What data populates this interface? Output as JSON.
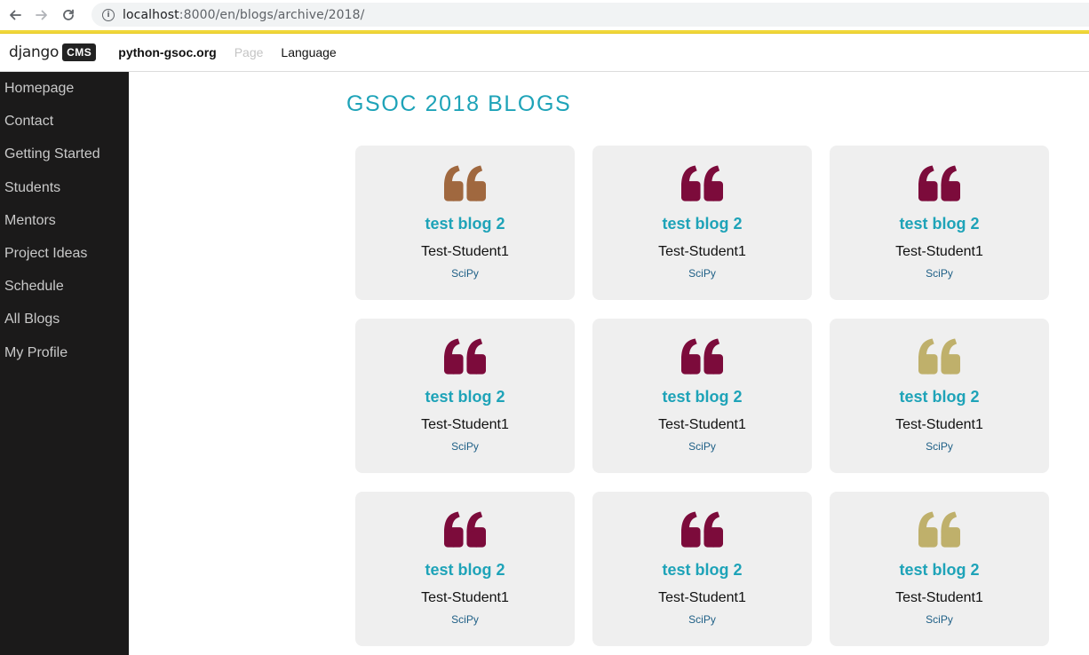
{
  "browser": {
    "url_host": "localhost",
    "url_rest": ":8000/en/blogs/archive/2018/"
  },
  "toolbar": {
    "logo_text": "django",
    "logo_badge": "CMS",
    "site": "python-gsoc.org",
    "page": "Page",
    "language": "Language"
  },
  "sidebar": {
    "items": [
      {
        "label": "Homepage"
      },
      {
        "label": "Contact"
      },
      {
        "label": "Getting Started"
      },
      {
        "label": "Students"
      },
      {
        "label": "Mentors"
      },
      {
        "label": "Project Ideas"
      },
      {
        "label": "Schedule"
      },
      {
        "label": "All Blogs"
      },
      {
        "label": "My Profile"
      }
    ]
  },
  "page_title": "GSOC 2018 BLOGS",
  "cards": [
    {
      "title": "test blog 2",
      "author": "Test-Student1",
      "org": "SciPy",
      "quote_color": "#a0683f"
    },
    {
      "title": "test blog 2",
      "author": "Test-Student1",
      "org": "SciPy",
      "quote_color": "#7c0b3b"
    },
    {
      "title": "test blog 2",
      "author": "Test-Student1",
      "org": "SciPy",
      "quote_color": "#7c0b3b"
    },
    {
      "title": "test blog 2",
      "author": "Test-Student1",
      "org": "SciPy",
      "quote_color": "#7c0b3b"
    },
    {
      "title": "test blog 2",
      "author": "Test-Student1",
      "org": "SciPy",
      "quote_color": "#7c0b3b"
    },
    {
      "title": "test blog 2",
      "author": "Test-Student1",
      "org": "SciPy",
      "quote_color": "#bfb06b"
    },
    {
      "title": "test blog 2",
      "author": "Test-Student1",
      "org": "SciPy",
      "quote_color": "#7c0b3b"
    },
    {
      "title": "test blog 2",
      "author": "Test-Student1",
      "org": "SciPy",
      "quote_color": "#7c0b3b"
    },
    {
      "title": "test blog 2",
      "author": "Test-Student1",
      "org": "SciPy",
      "quote_color": "#bfb06b"
    }
  ]
}
